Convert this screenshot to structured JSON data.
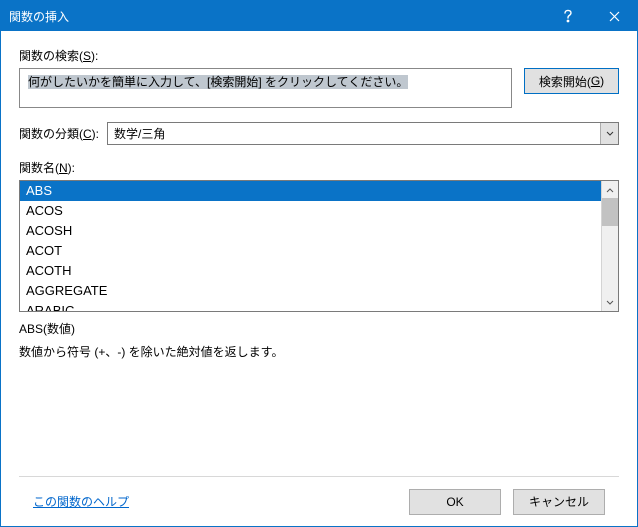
{
  "title": "関数の挿入",
  "search": {
    "label_pre": "関数の検索(",
    "label_key": "S",
    "label_post": "):",
    "text": "何がしたいかを簡単に入力して、[検索開始] をクリックしてください。",
    "button_pre": "検索開始(",
    "button_key": "G",
    "button_post": ")"
  },
  "category": {
    "label_pre": "関数の分類(",
    "label_key": "C",
    "label_post": "):",
    "value": "数学/三角"
  },
  "functions": {
    "label_pre": "関数名(",
    "label_key": "N",
    "label_post": "):",
    "items": [
      "ABS",
      "ACOS",
      "ACOSH",
      "ACOT",
      "ACOTH",
      "AGGREGATE",
      "ARABIC"
    ],
    "selected_index": 0
  },
  "description": {
    "signature": "ABS(数値)",
    "text": "数値から符号 (+、-) を除いた絶対値を返します。"
  },
  "footer": {
    "help": "この関数のヘルプ",
    "ok": "OK",
    "cancel": "キャンセル"
  }
}
